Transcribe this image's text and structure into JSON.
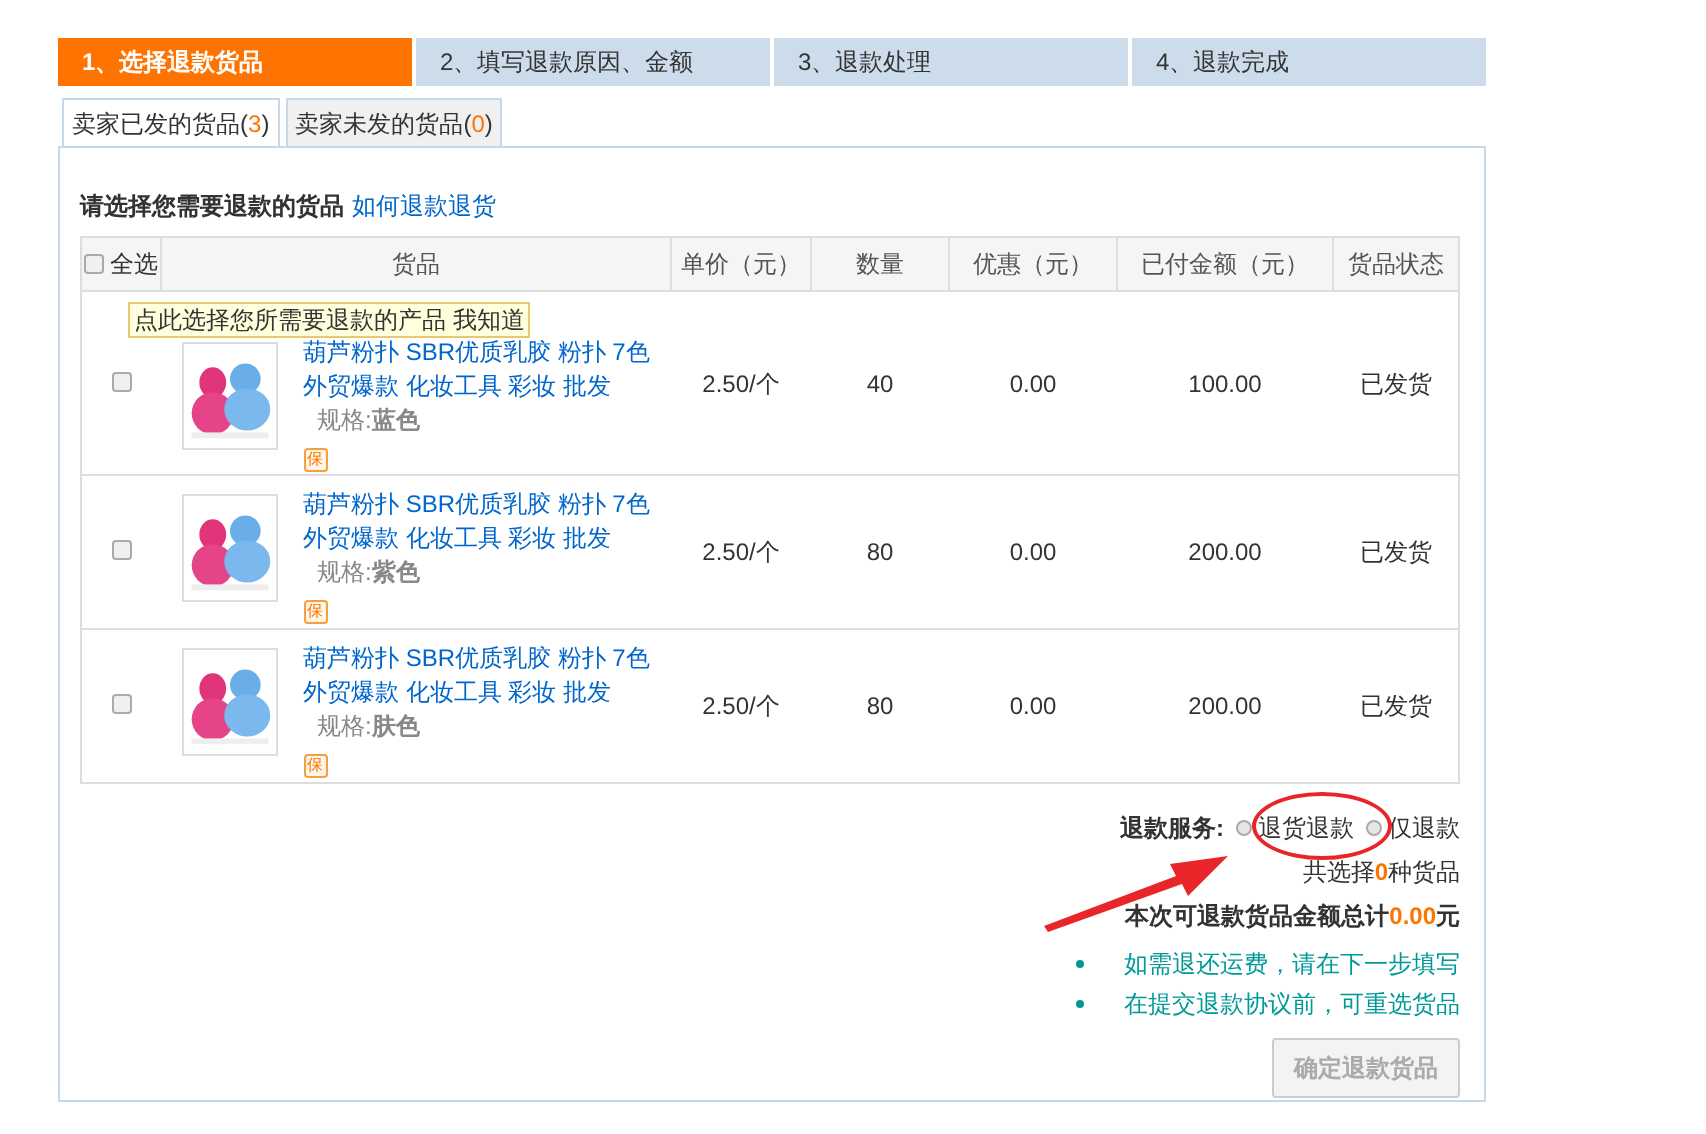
{
  "steps": [
    {
      "label": "1、选择退款货品",
      "selected": true
    },
    {
      "label": "2、填写退款原因、金额",
      "selected": false
    },
    {
      "label": "3、退款处理",
      "selected": false
    },
    {
      "label": "4、退款完成",
      "selected": false
    }
  ],
  "tabs": [
    {
      "label": "卖家已发的货品(",
      "count": "3",
      "close": ")",
      "selected": true
    },
    {
      "label": "卖家未发的货品(",
      "count": "0",
      "close": ")",
      "selected": false
    }
  ],
  "heading": "请选择您需要退款的货品",
  "help_link": "如何退款退货",
  "tooltip": {
    "text": "点此选择您所需要退款的产品 我知道"
  },
  "table": {
    "select_all": {
      "label": "全选",
      "checked": false
    },
    "columns": [
      "货品",
      "单价（元）",
      "数量",
      "优惠（元）",
      "已付金额（元）",
      "货品状态"
    ],
    "rows": [
      {
        "checked": false,
        "title": "葫芦粉扑 SBR优质乳胶 粉扑 7色外贸爆款 化妆工具 彩妆 批发",
        "spec_label": "规格:",
        "spec_value": "蓝色",
        "badge": "保",
        "price": "2.50/个",
        "quantity": "40",
        "discount": "0.00",
        "paid": "100.00",
        "status": "已发货"
      },
      {
        "checked": false,
        "title": "葫芦粉扑 SBR优质乳胶 粉扑 7色外贸爆款 化妆工具 彩妆 批发",
        "spec_label": "规格:",
        "spec_value": "紫色",
        "badge": "保",
        "price": "2.50/个",
        "quantity": "80",
        "discount": "0.00",
        "paid": "200.00",
        "status": "已发货"
      },
      {
        "checked": false,
        "title": "葫芦粉扑 SBR优质乳胶 粉扑 7色外贸爆款 化妆工具 彩妆 批发",
        "spec_label": "规格:",
        "spec_value": "肤色",
        "badge": "保",
        "price": "2.50/个",
        "quantity": "80",
        "discount": "0.00",
        "paid": "200.00",
        "status": "已发货"
      }
    ]
  },
  "service": {
    "label": "退款服务:",
    "options": [
      {
        "label": "退货退款",
        "selected": false
      },
      {
        "label": "仅退款",
        "selected": false
      }
    ]
  },
  "selected_count": {
    "prefix": "共选择",
    "value": "0",
    "suffix": "种货品"
  },
  "total": {
    "prefix": "本次可退款货品金额总计",
    "value": "0.00",
    "suffix": "元"
  },
  "notes": [
    "如需退还运费，请在下一步填写",
    "在提交退款协议前，可重选货品"
  ],
  "confirm_button": {
    "label": "确定退款货品",
    "disabled": true
  }
}
